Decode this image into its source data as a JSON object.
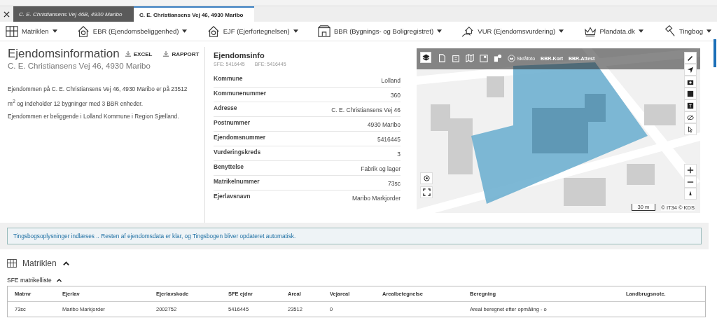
{
  "tabs": [
    {
      "label": "C. E. Christiansens Vej 46B, 4930 Maribo",
      "selected": false
    },
    {
      "label": "C. E. Christiansens Vej 46, 4930 Maribo",
      "selected": true
    }
  ],
  "nav": [
    {
      "label": "Matriklen"
    },
    {
      "label": "EBR (Ejendomsbeliggenhed)"
    },
    {
      "label": "EJF (Ejerfortegnelsen)"
    },
    {
      "label": "BBR (Bygnings- og Boligregistret)"
    },
    {
      "label": "VUR (Ejendomsvurdering)"
    },
    {
      "label": "Plandata.dk"
    },
    {
      "label": "Tingbog"
    }
  ],
  "header": {
    "title": "Ejendomsinformation",
    "excel": "EXCEL",
    "rapport": "RAPPORT",
    "address": "C. E. Christiansens Vej 46, 4930 Maribo"
  },
  "description": [
    "Ejendommen på C. E. Christiansens Vej 46, 4930 Maribo er på 23512 m$^{2}$ og indeholder 12 bygninger med 3 BBR enheder.",
    "Ejendommen er beliggende i Lolland Kommune i Region Sjælland."
  ],
  "info": {
    "title": "Ejendomsinfo",
    "ids": [
      "SFE: 5416445",
      "BFE: 5416445"
    ],
    "rows": [
      {
        "label": "Kommune",
        "value": "Lolland"
      },
      {
        "label": "Kommunenummer",
        "value": "360"
      },
      {
        "label": "Adresse",
        "value": "C. E. Christiansens Vej 46"
      },
      {
        "label": "Postnummer",
        "value": "4930 Maribo"
      },
      {
        "label": "Ejendomsnummer",
        "value": "5416445"
      },
      {
        "label": "Vurderingskreds",
        "value": "3"
      },
      {
        "label": "Benyttelse",
        "value": "Fabrik og lager"
      },
      {
        "label": "Matrikelnummer",
        "value": "73sc"
      },
      {
        "label": "Ejerlavsnavn",
        "value": "Maribo Markjorder"
      }
    ]
  },
  "map": {
    "kind": "picture",
    "toolbar": [
      "Skråfoto",
      "BBR-Kort",
      "BBR-Attest"
    ],
    "scale": "30 m",
    "attribution": "© IT34 © KDS"
  },
  "banner": "Tingsbogsoplysninger indlæses .. Resten af ejendomsdata er klar, og Tingsbogen bliver opdateret automatisk.",
  "section": {
    "title": "Matriklen",
    "expanded": true,
    "subtitle": "SFE matrikelliste",
    "sub_expanded": true
  },
  "table": {
    "columns": [
      "Matrnr",
      "Ejerlav",
      "Ejerlavskode",
      "SFE ejdnr",
      "Areal",
      "Vejareal",
      "Arealbetegnelse",
      "Beregning",
      "Landbrugsnote."
    ],
    "rows": [
      [
        "73sc",
        "Maribo Markjorder",
        "2002752",
        "5416445",
        "23512",
        "0",
        "",
        "Areal beregnet efter opmåling - o",
        ""
      ]
    ]
  }
}
